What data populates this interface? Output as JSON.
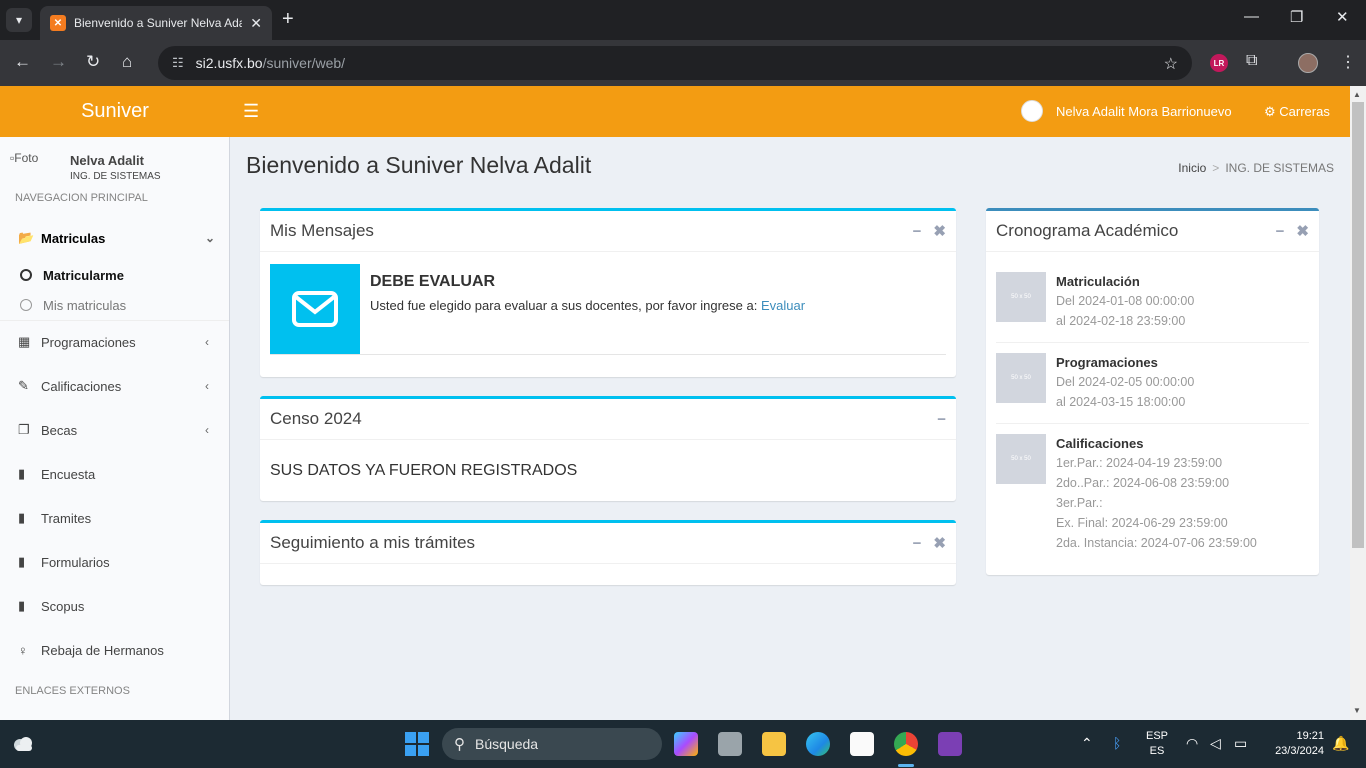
{
  "browser": {
    "tab_title": "Bienvenido a Suniver Nelva Adalit",
    "tab_favicon": "XAMPP",
    "url_host": "si2.usfx.bo",
    "url_path": "/suniver/web/",
    "ext_badge": "LR"
  },
  "header": {
    "logo": "Suniver",
    "user_name": "Nelva Adalit Mora Barrionuevo",
    "carreras_label": "Carreras",
    "accent": "#f39c12"
  },
  "sidebar": {
    "photo_alt": "Foto",
    "user_name": "Nelva Adalit",
    "user_career": "ING. DE SISTEMAS",
    "nav_header": "NAVEGACION PRINCIPAL",
    "items": [
      {
        "label": "Matriculas",
        "icon": "folder-open-icon"
      },
      {
        "label": "Programaciones",
        "icon": "table-icon"
      },
      {
        "label": "Calificaciones",
        "icon": "edit-icon"
      },
      {
        "label": "Becas",
        "icon": "clone-icon"
      },
      {
        "label": "Encuesta",
        "icon": "book-icon"
      },
      {
        "label": "Tramites",
        "icon": "book-icon"
      },
      {
        "label": "Formularios",
        "icon": "book-icon"
      },
      {
        "label": "Scopus",
        "icon": "book-icon"
      },
      {
        "label": "Rebaja de Hermanos",
        "icon": "female-icon"
      }
    ],
    "sub_items": [
      {
        "label": "Matricularme"
      },
      {
        "label": "Mis matriculas"
      }
    ],
    "external_header": "ENLACES EXTERNOS"
  },
  "page": {
    "title": "Bienvenido a Suniver Nelva Adalit",
    "breadcrumb_home": "Inicio",
    "breadcrumb_current": "ING. DE SISTEMAS"
  },
  "messages_box": {
    "title": "Mis Mensajes",
    "msg_title": "DEBE EVALUAR",
    "msg_text": "Usted fue elegido para evaluar a sus docentes, por favor ingrese a:",
    "msg_link": "Evaluar"
  },
  "censo_box": {
    "title": "Censo 2024",
    "text": "SUS DATOS YA FUERON REGISTRADOS"
  },
  "tramites_box": {
    "title": "Seguimiento a mis trámites"
  },
  "cronograma_box": {
    "title": "Cronograma Académico",
    "thumb": "50 x 50",
    "items": [
      {
        "name": "Matriculación",
        "lines": [
          "Del 2024-01-08 00:00:00",
          "al 2024-02-18 23:59:00"
        ]
      },
      {
        "name": "Programaciones",
        "lines": [
          "Del 2024-02-05 00:00:00",
          "al 2024-03-15 18:00:00"
        ]
      },
      {
        "name": "Calificaciones",
        "lines": [
          "1er.Par.: 2024-04-19 23:59:00",
          "2do..Par.: 2024-06-08 23:59:00",
          "3er.Par.:",
          "Ex. Final: 2024-06-29 23:59:00",
          "2da. Instancia: 2024-07-06 23:59:00"
        ]
      }
    ]
  },
  "taskbar": {
    "search_placeholder": "Búsqueda",
    "lang_top": "ESP",
    "lang_bottom": "ES",
    "time": "19:21",
    "date": "23/3/2024"
  }
}
